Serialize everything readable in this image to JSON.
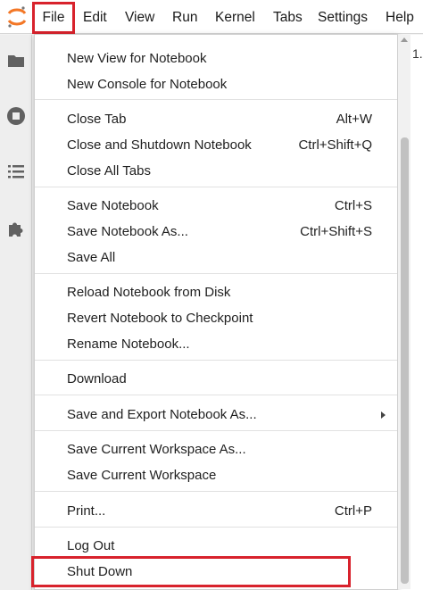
{
  "menubar": {
    "items": [
      "File",
      "Edit",
      "View",
      "Run",
      "Kernel",
      "Tabs",
      "Settings",
      "Help"
    ]
  },
  "sidebar": {
    "icons": [
      "folder-icon",
      "stop-circle-icon",
      "list-icon",
      "puzzle-icon"
    ]
  },
  "background": {
    "partial_text": "1."
  },
  "file_menu": {
    "items": [
      {
        "label": "New View for Notebook",
        "shortcut": ""
      },
      {
        "label": "New Console for Notebook",
        "shortcut": ""
      },
      {
        "label": "Close Tab",
        "shortcut": "Alt+W"
      },
      {
        "label": "Close and Shutdown Notebook",
        "shortcut": "Ctrl+Shift+Q"
      },
      {
        "label": "Close All Tabs",
        "shortcut": ""
      },
      {
        "label": "Save Notebook",
        "shortcut": "Ctrl+S"
      },
      {
        "label": "Save Notebook As...",
        "shortcut": "Ctrl+Shift+S"
      },
      {
        "label": "Save All",
        "shortcut": ""
      },
      {
        "label": "Reload Notebook from Disk",
        "shortcut": ""
      },
      {
        "label": "Revert Notebook to Checkpoint",
        "shortcut": ""
      },
      {
        "label": "Rename Notebook...",
        "shortcut": ""
      },
      {
        "label": "Download",
        "shortcut": ""
      },
      {
        "label": "Save and Export Notebook As...",
        "shortcut": ""
      },
      {
        "label": "Save Current Workspace As...",
        "shortcut": ""
      },
      {
        "label": "Save Current Workspace",
        "shortcut": ""
      },
      {
        "label": "Print...",
        "shortcut": "Ctrl+P"
      },
      {
        "label": "Log Out",
        "shortcut": ""
      },
      {
        "label": "Shut Down",
        "shortcut": ""
      }
    ]
  },
  "colors": {
    "highlight": "#d8222c",
    "logo_orange": "#f37726"
  }
}
